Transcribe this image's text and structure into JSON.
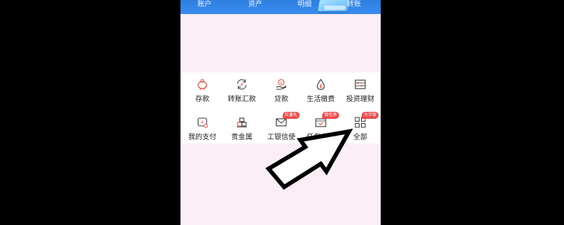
{
  "top_tabs": [
    {
      "label": "账户"
    },
    {
      "label": "资产"
    },
    {
      "label": "明细"
    },
    {
      "label": "转账"
    }
  ],
  "services": [
    {
      "label": "存款",
      "icon": "piggy-bank-icon"
    },
    {
      "label": "转账汇款",
      "icon": "transfer-icon"
    },
    {
      "label": "贷款",
      "icon": "loan-hand-icon"
    },
    {
      "label": "生活缴费",
      "icon": "utility-drop-icon"
    },
    {
      "label": "投资理财",
      "icon": "abacus-icon"
    },
    {
      "label": "我的支付",
      "icon": "wallet-icon"
    },
    {
      "label": "贵金属",
      "icon": "gold-bars-icon"
    },
    {
      "label": "工银信使",
      "icon": "envelope-icon",
      "badge": "应量礼"
    },
    {
      "label": "任务中心",
      "icon": "calendar-check-icon",
      "badge": "做任务"
    },
    {
      "label": "全部",
      "icon": "grid-icon",
      "badge": "大字版"
    }
  ],
  "colors": {
    "brand_red": "#e0453e",
    "top_blue": "#3a8cf0",
    "page_bg": "#fbeef6",
    "badge_red": "#e84b4b"
  }
}
